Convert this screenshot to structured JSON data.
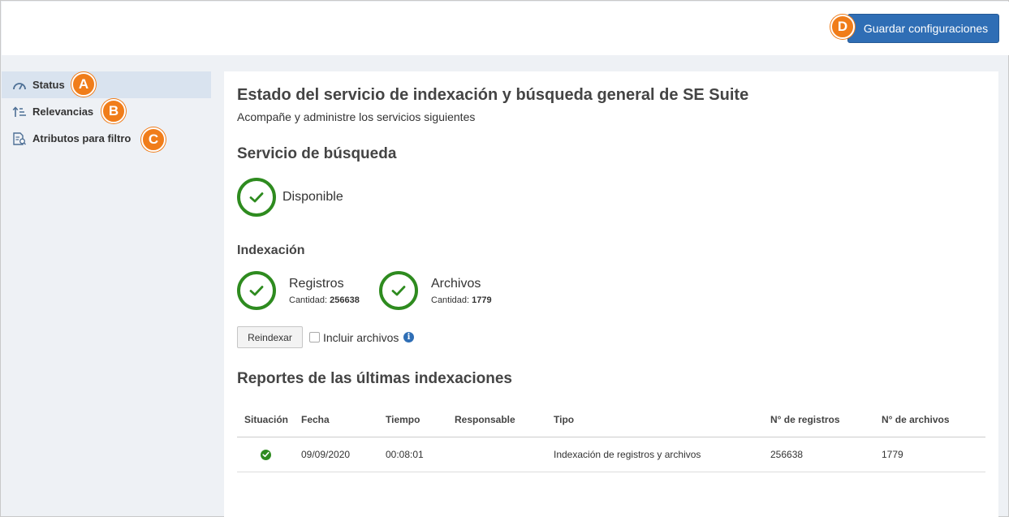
{
  "toolbar": {
    "save_label": "Guardar configuraciones"
  },
  "markers": {
    "a": "A",
    "b": "B",
    "c": "C",
    "d": "D"
  },
  "colors": {
    "primary": "#2f6eb5",
    "success": "#2e8b1f",
    "marker": "#f07d1a",
    "sidebar_active": "#d9e3ef"
  },
  "sidebar": {
    "items": [
      {
        "label": "Status",
        "icon": "gauge-icon",
        "active": true
      },
      {
        "label": "Relevancias",
        "icon": "sort-icon",
        "active": false
      },
      {
        "label": "Atributos para filtro",
        "icon": "document-filter-icon",
        "active": false
      }
    ]
  },
  "main": {
    "title": "Estado del servicio de indexación y búsqueda general de SE Suite",
    "subtitle": "Acompañe y administre los servicios siguientes",
    "search_service": {
      "title": "Servicio de búsqueda",
      "status": "Disponible"
    },
    "indexing": {
      "title": "Indexación",
      "records": {
        "label": "Registros",
        "count_label": "Cantidad:",
        "count": "256638"
      },
      "files": {
        "label": "Archivos",
        "count_label": "Cantidad:",
        "count": "1779"
      },
      "reindex_label": "Reindexar",
      "include_files_label": "Incluir archivos",
      "include_files_checked": false,
      "info_glyph": "i"
    },
    "reports": {
      "title": "Reportes de las últimas indexaciones",
      "columns": [
        "Situación",
        "Fecha",
        "Tiempo",
        "Responsable",
        "Tipo",
        "N° de registros",
        "N° de archivos"
      ],
      "rows": [
        {
          "status": "ok",
          "date": "09/09/2020",
          "time": "00:08:01",
          "responsible": "",
          "type": "Indexación de registros y archivos",
          "records": "256638",
          "files": "1779"
        }
      ]
    }
  }
}
